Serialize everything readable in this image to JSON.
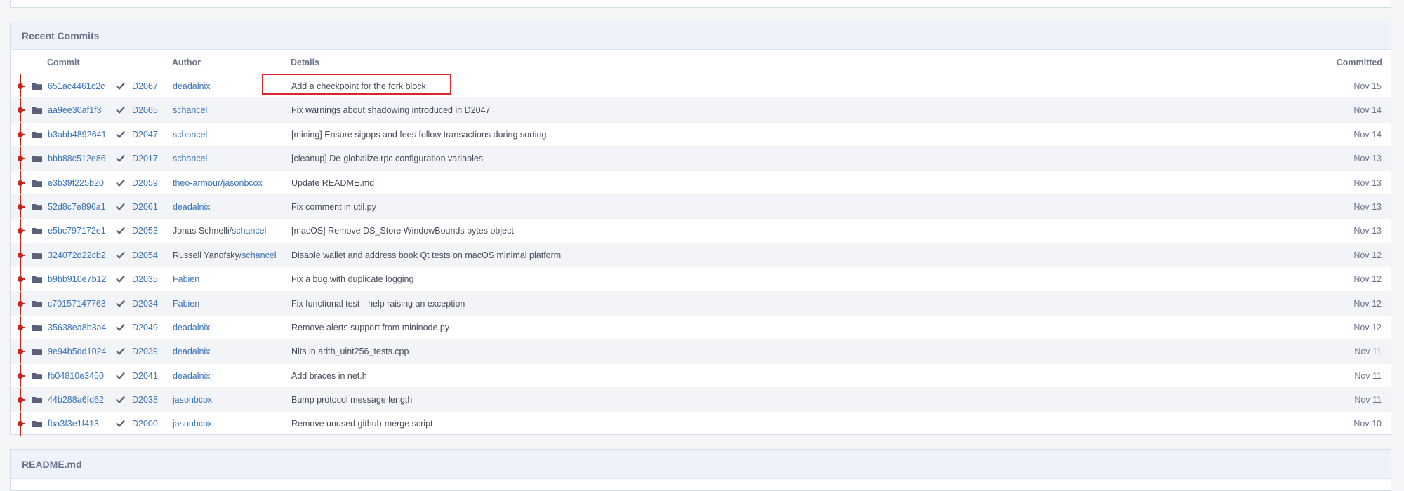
{
  "panel_title": "Recent Commits",
  "columns": {
    "commit": "Commit",
    "author": "Author",
    "details": "Details",
    "committed": "Committed"
  },
  "commits": [
    {
      "hash": "651ac4461c2c",
      "diff": "D2067",
      "author_prefix": "",
      "author": "deadalnix",
      "details": "Add a checkpoint for the fork block",
      "date": "Nov 15"
    },
    {
      "hash": "aa9ee30af1f3",
      "diff": "D2065",
      "author_prefix": "",
      "author": "schancel",
      "details": "Fix warnings about shadowing introduced in D2047",
      "date": "Nov 14"
    },
    {
      "hash": "b3abb4892641",
      "diff": "D2047",
      "author_prefix": "",
      "author": "schancel",
      "details": "[mining] Ensure sigops and fees follow transactions during sorting",
      "date": "Nov 14"
    },
    {
      "hash": "bbb88c512e86",
      "diff": "D2017",
      "author_prefix": "",
      "author": "schancel",
      "details": "[cleanup] De-globalize rpc configuration variables",
      "date": "Nov 13"
    },
    {
      "hash": "e3b39f225b20",
      "diff": "D2059",
      "author_prefix": "",
      "author": "theo-armour/jasonbcox",
      "details": "Update README.md",
      "date": "Nov 13"
    },
    {
      "hash": "52d8c7e896a1",
      "diff": "D2061",
      "author_prefix": "",
      "author": "deadalnix",
      "details": "Fix comment in util.py",
      "date": "Nov 13"
    },
    {
      "hash": "e5bc797172e1",
      "diff": "D2053",
      "author_prefix": "Jonas Schnelli/",
      "author": "schancel",
      "details": "[macOS] Remove DS_Store WindowBounds bytes object",
      "date": "Nov 13"
    },
    {
      "hash": "324072d22cb2",
      "diff": "D2054",
      "author_prefix": "Russell Yanofsky/",
      "author": "schancel",
      "details": "Disable wallet and address book Qt tests on macOS minimal platform",
      "date": "Nov 12"
    },
    {
      "hash": "b9bb910e7b12",
      "diff": "D2035",
      "author_prefix": "",
      "author": "Fabien",
      "details": "Fix a bug with duplicate logging",
      "date": "Nov 12"
    },
    {
      "hash": "c70157147763",
      "diff": "D2034",
      "author_prefix": "",
      "author": "Fabien",
      "details": "Fix functional test --help raising an exception",
      "date": "Nov 12"
    },
    {
      "hash": "35638ea8b3a4",
      "diff": "D2049",
      "author_prefix": "",
      "author": "deadalnix",
      "details": "Remove alerts support from mininode.py",
      "date": "Nov 12"
    },
    {
      "hash": "9e94b5dd1024",
      "diff": "D2039",
      "author_prefix": "",
      "author": "deadalnix",
      "details": "Nits in arith_uint256_tests.cpp",
      "date": "Nov 11"
    },
    {
      "hash": "fb04810e3450",
      "diff": "D2041",
      "author_prefix": "",
      "author": "deadalnix",
      "details": "Add braces in net.h",
      "date": "Nov 11"
    },
    {
      "hash": "44b288a6fd62",
      "diff": "D2038",
      "author_prefix": "",
      "author": "jasonbcox",
      "details": "Bump protocol message length",
      "date": "Nov 11"
    },
    {
      "hash": "fba3f3e1f413",
      "diff": "D2000",
      "author_prefix": "",
      "author": "jasonbcox",
      "details": "Remove unused github-merge script",
      "date": "Nov 10"
    }
  ],
  "readme_title": "README.md",
  "colors": {
    "graph": "#c4261b",
    "link": "#3a73b5",
    "highlight": "#d9262b"
  },
  "icons": {
    "row_type": "folder-icon",
    "build_status": "check-icon"
  }
}
